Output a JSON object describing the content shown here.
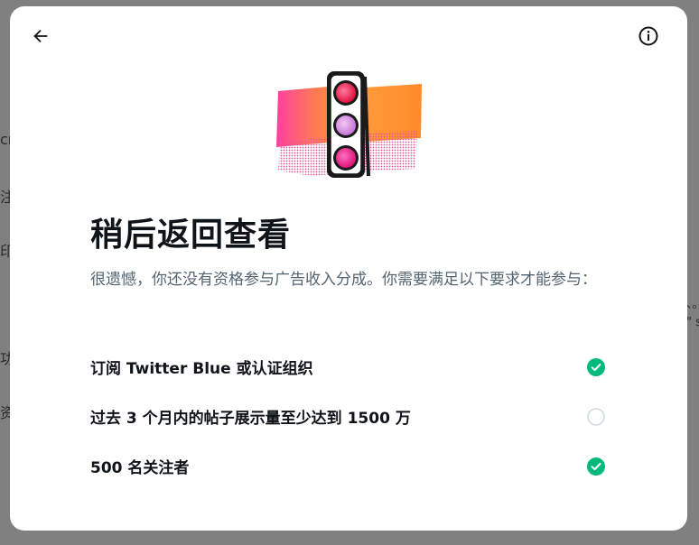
{
  "background": {
    "left_fragments": [
      "cr",
      "注和",
      "印实",
      "功能",
      "资源"
    ],
    "right_fragments": [
      "、。",
      "\" s"
    ]
  },
  "modal": {
    "back_icon": "arrow-left-icon",
    "info_icon": "info-circle-icon",
    "title": "稍后返回查看",
    "subtitle": "很遗憾，你还没有资格参与广告收入分成。你需要满足以下要求才能参与：",
    "requirements": [
      {
        "text": "订阅 Twitter Blue 或认证组织",
        "met": true,
        "icon": "check-circle-icon"
      },
      {
        "text": "过去 3 个月内的帖子展示量至少达到 1500 万",
        "met": false,
        "icon": "empty-circle-icon"
      },
      {
        "text": "500 名关注者",
        "met": true,
        "icon": "check-circle-icon"
      }
    ]
  },
  "colors": {
    "met": "#00ba7c",
    "unmet_border": "#cfd9de",
    "text_primary": "#0f1419",
    "text_secondary": "#536471"
  }
}
